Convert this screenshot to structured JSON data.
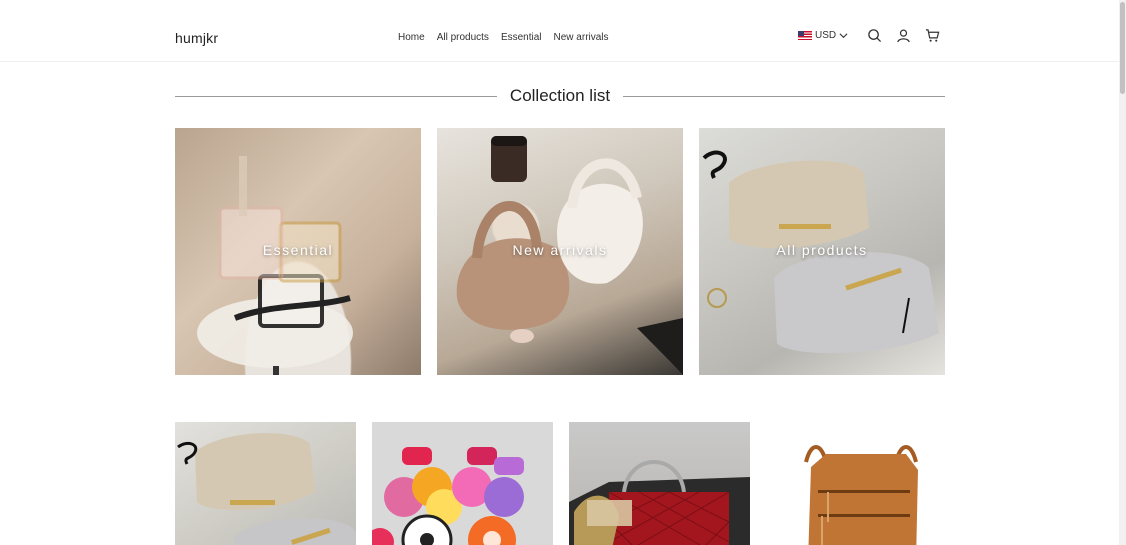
{
  "header": {
    "logo": "humjkr",
    "nav": [
      "Home",
      "All products",
      "Essential",
      "New arrivals"
    ],
    "currency": "USD"
  },
  "icons": {
    "flag": "us-flag-icon",
    "chevron": "chevron-down-icon",
    "search": "search-icon",
    "account": "user-icon",
    "cart": "cart-icon"
  },
  "section_title": "Collection list",
  "collections": [
    {
      "label": "Essential"
    },
    {
      "label": "New arrivals"
    },
    {
      "label": "All products"
    }
  ]
}
